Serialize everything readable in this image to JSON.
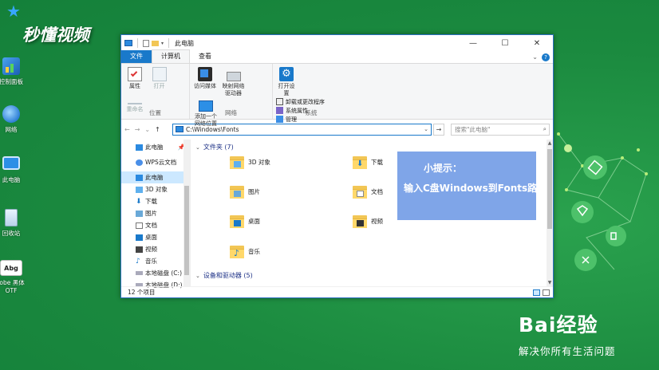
{
  "watermark": {
    "logo_text": "秒懂视频"
  },
  "desktop_icons": [
    {
      "label": "控制面板",
      "icon": "control-panel-icon"
    },
    {
      "label": "网络",
      "icon": "network-icon"
    },
    {
      "label": "此电脑",
      "icon": "this-pc-icon"
    },
    {
      "label": "回收站",
      "icon": "recycle-bin-icon"
    },
    {
      "label": "Abg",
      "label2": "lobe 黑体",
      "label3": "OTF",
      "icon": "font-file-icon"
    }
  ],
  "window": {
    "title": "此电脑",
    "controls": {
      "minimize": "—",
      "maximize": "☐",
      "close": "✕"
    },
    "tabs": [
      "文件",
      "计算机",
      "查看"
    ],
    "ribbon": {
      "location": {
        "label": "位置",
        "buttons": [
          "属性",
          "打开",
          "重命名"
        ]
      },
      "network": {
        "label": "网络",
        "buttons": [
          "访问媒体",
          "映射网络驱动器",
          "添加一个网络位置"
        ]
      },
      "system": {
        "label": "系统",
        "open_settings": "打开设置",
        "small": [
          "卸载或更改程序",
          "系统属性",
          "管理"
        ]
      }
    },
    "address": {
      "path": "C:\\Windows\\Fonts",
      "search_placeholder": "搜索\"此电脑\""
    },
    "nav_pane": [
      {
        "label": "此电脑",
        "icon": "pc-icon",
        "pinned": true
      },
      {
        "label": "WPS云文档",
        "icon": "cloud-icon"
      },
      {
        "label": "此电脑",
        "icon": "pc-icon",
        "selected": true
      },
      {
        "label": "3D 对象",
        "icon": "3d-objects-icon"
      },
      {
        "label": "下载",
        "icon": "download-icon"
      },
      {
        "label": "图片",
        "icon": "pictures-icon"
      },
      {
        "label": "文档",
        "icon": "documents-icon"
      },
      {
        "label": "桌面",
        "icon": "desktop-icon"
      },
      {
        "label": "视频",
        "icon": "videos-icon"
      },
      {
        "label": "音乐",
        "icon": "music-icon"
      },
      {
        "label": "本地磁盘 (C:)",
        "icon": "drive-icon"
      },
      {
        "label": "本地磁盘 (D:)",
        "icon": "drive-icon"
      }
    ],
    "sections": {
      "folders": "文件夹 (7)",
      "devices": "设备和驱动器 (5)"
    },
    "folders": [
      {
        "label": "3D 对象",
        "icon": "3d-objects-icon"
      },
      {
        "label": "下载",
        "icon": "download-icon"
      },
      {
        "label": "图片",
        "icon": "pictures-icon"
      },
      {
        "label": "文档",
        "icon": "documents-icon"
      },
      {
        "label": "桌面",
        "icon": "desktop-icon"
      },
      {
        "label": "视频",
        "icon": "videos-icon"
      },
      {
        "label": "音乐",
        "icon": "music-icon"
      }
    ],
    "status": "12 个项目"
  },
  "tip": {
    "title": "小提示：",
    "body": "输入C盘Windows到Fonts路径"
  },
  "brand": {
    "name": "Bai经验",
    "slogan": "解决你所有生活问题"
  },
  "colors": {
    "desktop_green": "#1b8a3f",
    "accent_blue": "#1979ca",
    "tip_blue": "#7fa5e8",
    "folder_yellow": "#ffd86a"
  }
}
